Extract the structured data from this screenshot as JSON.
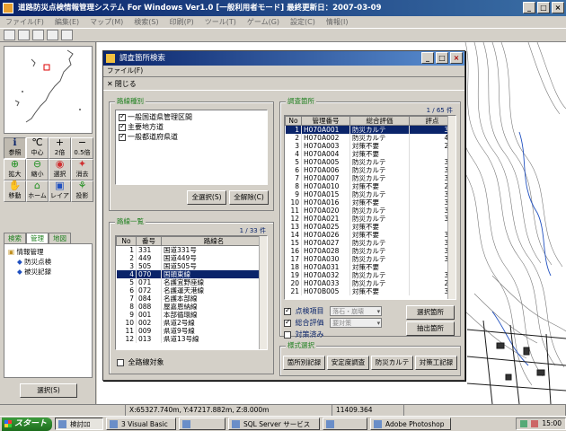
{
  "main_window": {
    "title": "道路防災点検情報管理システム For Windows Ver1.0 [一般利用者モード] 最終更新日：2007-03-09",
    "menus": [
      "ファイル(F)",
      "編集(E)",
      "マップ(M)",
      "検索(S)",
      "印刷(P)",
      "ツール(T)",
      "ゲーム(G)",
      "設定(C)",
      "情報(I)"
    ]
  },
  "tools": [
    {
      "icon": "ℹ",
      "label": "参照"
    },
    {
      "icon": "℃",
      "label": "中心"
    },
    {
      "icon": "+",
      "label": "2倍"
    },
    {
      "icon": "−",
      "label": "0.5倍"
    },
    {
      "icon": "⊕",
      "label": "拡大"
    },
    {
      "icon": "⊖",
      "label": "縮小"
    },
    {
      "icon": "◉",
      "label": "選択"
    },
    {
      "icon": "✦",
      "label": "消去"
    },
    {
      "icon": "✋",
      "label": "移動"
    },
    {
      "icon": "⌂",
      "label": "ホーム"
    },
    {
      "icon": "▣",
      "label": "レイア"
    },
    {
      "icon": "⚘",
      "label": "投影"
    }
  ],
  "left_tabs": [
    "検索",
    "管理",
    "地図"
  ],
  "tree": {
    "root": "情報管理",
    "children": [
      "防災点検",
      "被災記録"
    ]
  },
  "select_button": "選択(S)",
  "dialog": {
    "title": "調査箇所検索",
    "menu": "ファイル(F)",
    "close_label": "閉じる",
    "route_type_group": "路線種別",
    "route_types": [
      {
        "label": "一般国道県管理区間",
        "checked": true
      },
      {
        "label": "主要地方道",
        "checked": true
      },
      {
        "label": "一般都道府県道",
        "checked": true
      }
    ],
    "select_all": "全選択(S)",
    "deselect_all": "全解除(C)",
    "route_list_group": "路線一覧",
    "route_count": "1 / 33 件",
    "route_cols": [
      "No",
      "番号",
      "路線名"
    ],
    "routes": [
      [
        "1",
        "331",
        "国道331号"
      ],
      [
        "2",
        "449",
        "国道449号"
      ],
      [
        "3",
        "505",
        "国道505号"
      ],
      [
        "4",
        "070",
        "国頭東線"
      ],
      [
        "5",
        "071",
        "名護宜野座線"
      ],
      [
        "6",
        "072",
        "名護運天港線"
      ],
      [
        "7",
        "084",
        "名護本部線"
      ],
      [
        "8",
        "088",
        "屋嘉恩納線"
      ],
      [
        "9",
        "001",
        "本部循環線"
      ],
      [
        "10",
        "002",
        "県道2号線"
      ],
      [
        "11",
        "009",
        "県道9号線"
      ],
      [
        "12",
        "013",
        "県道13号線"
      ]
    ],
    "selected_route": 4,
    "all_routes_label": "全路線対象",
    "all_routes_checked": false,
    "survey_group": "調査箇所",
    "survey_count": "1 / 65 件",
    "survey_cols": [
      "No",
      "管理番号",
      "総合評価",
      "評点"
    ],
    "surveys": [
      [
        "1",
        "H070A001",
        "防災カルテ",
        "38"
      ],
      [
        "2",
        "H070A002",
        "防災カルテ",
        "49"
      ],
      [
        "3",
        "H070A003",
        "対策不要",
        "23"
      ],
      [
        "4",
        "H070A004",
        "対策不要",
        "8"
      ],
      [
        "5",
        "H070A005",
        "防災カルテ",
        "34"
      ],
      [
        "6",
        "H070A006",
        "防災カルテ",
        "34"
      ],
      [
        "7",
        "H070A007",
        "防災カルテ",
        "36"
      ],
      [
        "8",
        "H070A010",
        "対策不要",
        "27"
      ],
      [
        "9",
        "H070A015",
        "防災カルテ",
        "38"
      ],
      [
        "10",
        "H070A016",
        "対策不要",
        "31"
      ],
      [
        "11",
        "H070A020",
        "防災カルテ",
        "35"
      ],
      [
        "12",
        "H070A021",
        "防災カルテ",
        "31"
      ],
      [
        "13",
        "H070A025",
        "対策不要",
        ""
      ],
      [
        "14",
        "H070A026",
        "対策不要",
        "31"
      ],
      [
        "15",
        "H070A027",
        "防災カルテ",
        "31"
      ],
      [
        "16",
        "H070A028",
        "防災カルテ",
        "35"
      ],
      [
        "17",
        "H070A030",
        "防災カルテ",
        "31"
      ],
      [
        "18",
        "H070A031",
        "対策不要",
        ""
      ],
      [
        "19",
        "H070A032",
        "防災カルテ",
        "36"
      ],
      [
        "20",
        "H070A033",
        "防災カルテ",
        "28"
      ],
      [
        "21",
        "H070B005",
        "対策不要",
        "31"
      ]
    ],
    "selected_survey": 1,
    "filters": [
      {
        "label": "点検項目",
        "checked": true,
        "value": "落石・崩壊"
      },
      {
        "label": "総合評価",
        "checked": true,
        "value": "要対策"
      },
      {
        "label": "対策済み",
        "checked": false,
        "value": ""
      }
    ],
    "select_location": "選択箇所",
    "extract_location": "抽出箇所",
    "form_group": "様式選択",
    "form_buttons": [
      "箇所別記録",
      "安定度調査",
      "防災カルテ",
      "対策工記録"
    ]
  },
  "status": {
    "coords": "X:65327.740m, Y:47217.882m, Z:8.000m",
    "value": "11409.364"
  },
  "taskbar": {
    "start": "スタート",
    "tasks": [
      "検討ﾛﾛ",
      "3 Visual Basic",
      "",
      "SQL Server サービス",
      "",
      "Adobe Photoshop"
    ],
    "active_task": 0,
    "clock": "15:00"
  }
}
